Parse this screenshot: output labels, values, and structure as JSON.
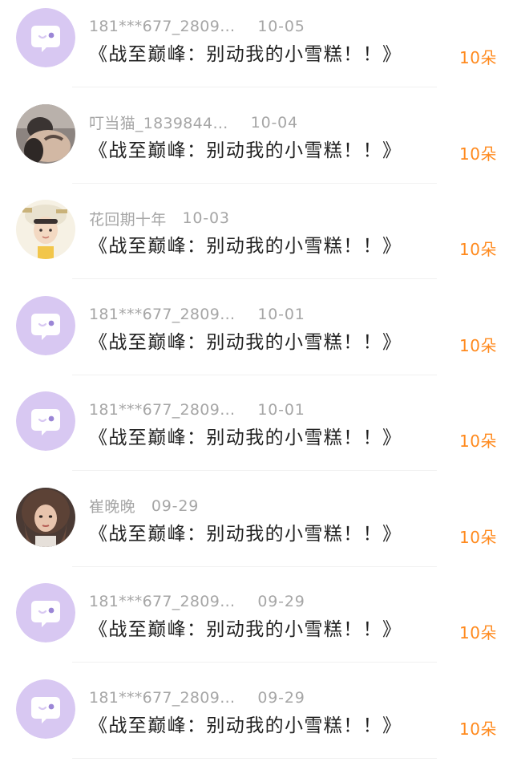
{
  "records": [
    {
      "avatar": "default-chat-avatar",
      "name": "181***677_2809…",
      "date": "10-05",
      "title": "《战至巅峰：别动我的小雪糕！！》",
      "count": "10朵"
    },
    {
      "avatar": "cat-photo-avatar",
      "name": "叮当猫_1839844…",
      "date": "10-04",
      "title": "《战至巅峰：别动我的小雪糕！！》",
      "count": "10朵"
    },
    {
      "avatar": "boy-photo-avatar",
      "name": "花回期十年",
      "date": "10-03",
      "title": "《战至巅峰：别动我的小雪糕！！》",
      "count": "10朵"
    },
    {
      "avatar": "default-chat-avatar",
      "name": "181***677_2809…",
      "date": "10-01",
      "title": "《战至巅峰：别动我的小雪糕！！》",
      "count": "10朵"
    },
    {
      "avatar": "default-chat-avatar",
      "name": "181***677_2809…",
      "date": "10-01",
      "title": "《战至巅峰：别动我的小雪糕！！》",
      "count": "10朵"
    },
    {
      "avatar": "girl-photo-avatar",
      "name": "崔晚晚",
      "date": "09-29",
      "title": "《战至巅峰：别动我的小雪糕！！》",
      "count": "10朵"
    },
    {
      "avatar": "default-chat-avatar",
      "name": "181***677_2809…",
      "date": "09-29",
      "title": "《战至巅峰：别动我的小雪糕！！》",
      "count": "10朵"
    },
    {
      "avatar": "default-chat-avatar",
      "name": "181***677_2809…",
      "date": "09-29",
      "title": "《战至巅峰：别动我的小雪糕！！》",
      "count": "10朵"
    }
  ],
  "colors": {
    "count": "#ff8a1e",
    "meta": "#a6a6a6",
    "title": "#222222",
    "avatar_bg": "#d8c8f2"
  }
}
